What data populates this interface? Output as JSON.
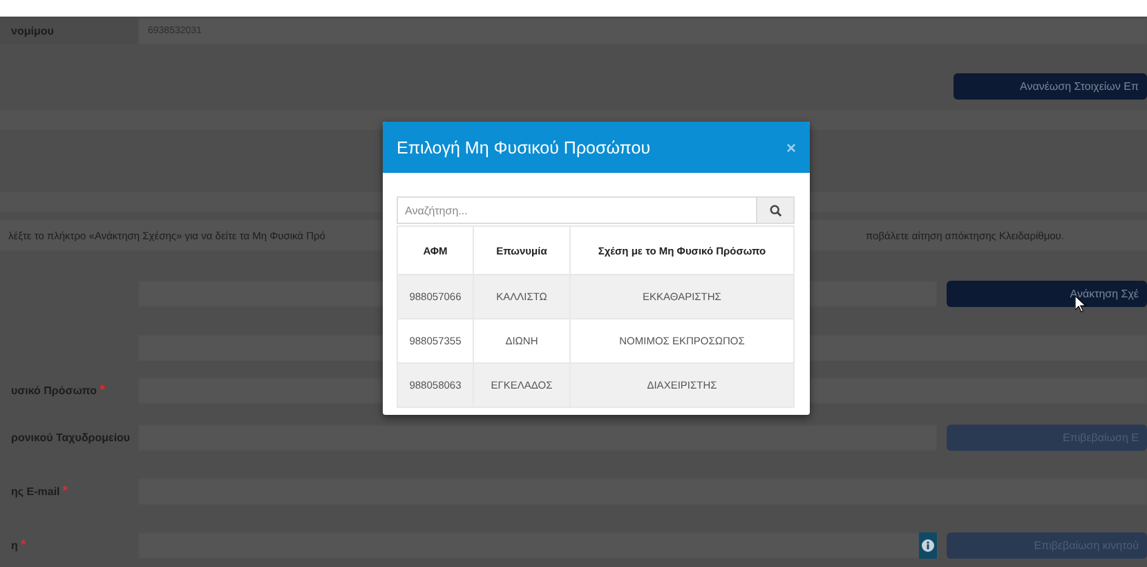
{
  "form": {
    "top_row": {
      "label": "νομίμου",
      "value": "6938532031"
    },
    "refresh_button": {
      "label": "Ανανέωση Στοιχείων Επ",
      "disabled": false
    },
    "info_text_left": "λέξτε το πλήκτρο «Ανάκτηση Σχέσης» για να δείτε τα Μη Φυσικά Πρό",
    "info_text_right": "ποβάλετε αίτηση απόκτησης Κλειδαρίθμου.",
    "rows": [
      {
        "button": {
          "label": "Ανάκτηση Σχέ",
          "disabled": false
        }
      },
      {},
      {
        "label": "υσικό Πρόσωπο",
        "mark": "*"
      },
      {
        "label": "ρονικού Ταχυδρομείου",
        "button": {
          "label": "Επιβεβαίωση E",
          "disabled": true
        }
      },
      {
        "label": "ης E-mail",
        "mark": "*"
      },
      {
        "label": "η",
        "mark": "*",
        "info": true,
        "button": {
          "label": "Επιβεβαίωση κινητού",
          "disabled": true
        }
      }
    ]
  },
  "modal": {
    "title": "Επιλογή Μη Φυσικού Προσώπου",
    "close": "×",
    "search": {
      "placeholder": "Αναζήτηση..."
    },
    "table": {
      "columns": [
        "ΑΦΜ",
        "Επωνυμία",
        "Σχέση με το Μη Φυσικό Πρόσωπο"
      ],
      "rows": [
        [
          "988057066",
          "ΚΑΛΛΙΣΤΩ",
          "ΕΚΚΑΘΑΡΙΣΤΗΣ"
        ],
        [
          "988057355",
          "ΔΙΩΝΗ",
          "ΝΟΜΙΜΟΣ ΕΚΠΡΟΣΩΠΟΣ"
        ],
        [
          "988058063",
          "ΕΓΚΕΛΑΔΟΣ",
          "ΔΙΑΧΕΙΡΙΣΤΗΣ"
        ]
      ]
    }
  }
}
